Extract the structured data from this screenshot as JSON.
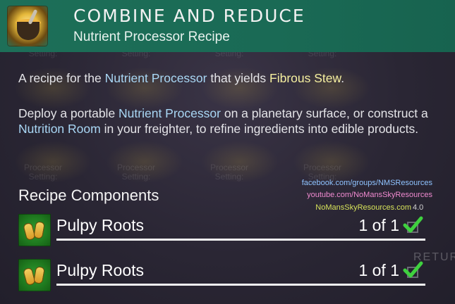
{
  "header": {
    "title": "COMBINE AND REDUCE",
    "subtitle": "Nutrient Processor Recipe",
    "icon": "fibrous-stew-icon"
  },
  "description": {
    "line1_prefix": "A recipe for the ",
    "line1_link": "Nutrient Processor",
    "line1_middle": " that yields ",
    "line1_product": "Fibrous Stew",
    "line1_suffix": ".",
    "para2_prefix": "Deploy a portable ",
    "para2_link1": "Nutrient Processor",
    "para2_middle1": " on a planetary surface, or construct a ",
    "para2_link2": "Nutrition Room",
    "para2_suffix": " in your freighter, to refine ingredients into edible products."
  },
  "section": {
    "title": "Recipe Components"
  },
  "watermark": {
    "facebook": "facebook.com/groups/NMSResources",
    "youtube": "youtube.com/NoMansSkyResources",
    "site": "NoMansSkyResources.com",
    "version": "4.0"
  },
  "components": [
    {
      "name": "Pulpy Roots",
      "count": "1 of 1",
      "icon": "pulpy-roots-icon",
      "checked": true
    },
    {
      "name": "Pulpy Roots",
      "count": "1 of 1",
      "icon": "pulpy-roots-icon",
      "checked": true
    }
  ],
  "background_text": {
    "setting": "Setting:",
    "processor": "Processor",
    "return": "RETURN"
  },
  "colors": {
    "header_bg": "#1d6f58",
    "highlight_blue": "#a9d7f5",
    "highlight_yellow": "#f6f0a0",
    "check_green": "#3fd13f"
  }
}
